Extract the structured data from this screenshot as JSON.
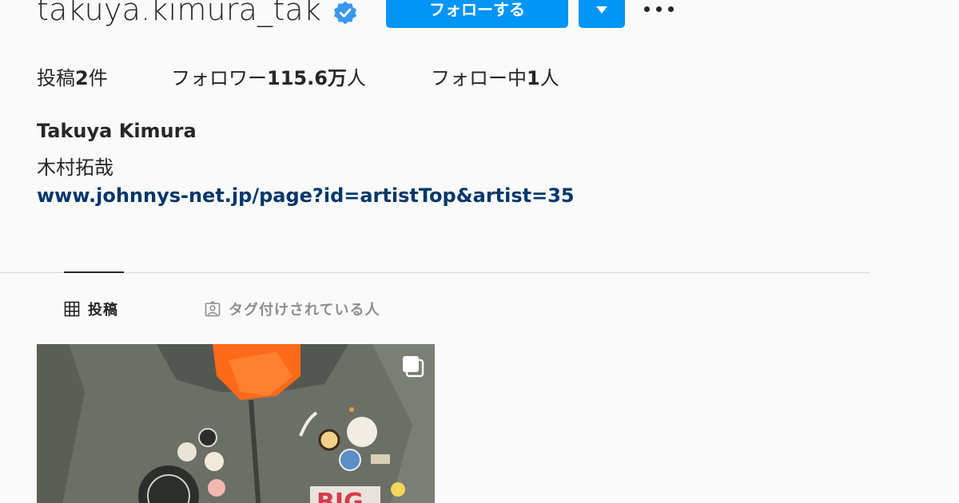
{
  "profile": {
    "username": "takuya.kimura_tak",
    "verified_icon": "verified-badge-icon",
    "follow_label": "フォローする",
    "dropdown_icon": "triangle-down-icon",
    "more_icon": "more-options-icon",
    "full_name": "Takuya Kimura",
    "bio": "木村拓哉",
    "link": "www.johnnys-net.jp/page?id=artistTop&artist=35"
  },
  "stats": {
    "posts_prefix": "投稿",
    "posts_count": "2",
    "posts_suffix": "件",
    "followers_prefix": "フォロワー",
    "followers_count": "115.6万",
    "followers_suffix": "人",
    "following_prefix": "フォロー中",
    "following_count": "1",
    "following_suffix": "人"
  },
  "tabs": [
    {
      "label": "投稿",
      "icon": "grid-icon",
      "active": true
    },
    {
      "label": "タグ付けされている人",
      "icon": "tagged-user-icon",
      "active": false
    }
  ],
  "colors": {
    "accent": "#0095f6",
    "link": "#00376b",
    "background": "#fafafa",
    "text": "#262626",
    "muted": "#8e8e8e"
  },
  "posts": [
    {
      "type": "multi-image",
      "icon": "multiple-images-icon"
    }
  ]
}
